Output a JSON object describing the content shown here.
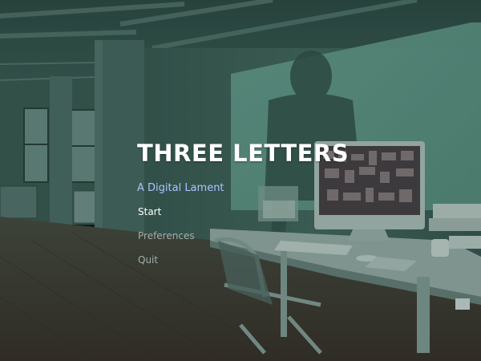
{
  "title": "THREE LETTERS",
  "subtitle": "A Digital Lament",
  "menu": {
    "start": "Start",
    "preferences": "Preferences",
    "quit": "Quit"
  },
  "colors": {
    "title": "#ffffff",
    "subtitle": "#a9c4ff",
    "menu_selected": "#ffffff",
    "menu_inactive": "#9fb0ab",
    "overlay_tint": "#0e2a24"
  }
}
